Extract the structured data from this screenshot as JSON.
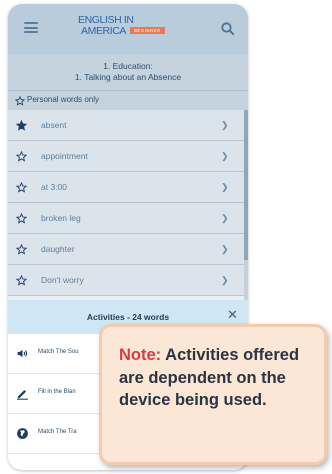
{
  "header": {
    "logo_line1": "ENGLISH IN",
    "logo_line2": "AMERICA",
    "logo_badge": "BEGINNER"
  },
  "lesson": {
    "line1": "1. Education:",
    "line2": "1. Talking about an Absence"
  },
  "filter": {
    "label": "Personal words only"
  },
  "words": [
    {
      "text": "absent",
      "starred": true
    },
    {
      "text": "appointment",
      "starred": false
    },
    {
      "text": "at 3:00",
      "starred": false
    },
    {
      "text": "broken leg",
      "starred": false
    },
    {
      "text": "daughter",
      "starred": false
    },
    {
      "text": "Don't worry",
      "starred": false
    }
  ],
  "activities": {
    "title": "Activities - 24 words",
    "items": [
      {
        "label": "Match The Sou",
        "icon": "speaker-icon"
      },
      {
        "label": "Fill in the Blan",
        "icon": "pencil-icon"
      },
      {
        "label": "Match The Tra",
        "icon": "globe-icon"
      }
    ]
  },
  "note": {
    "prefix": "Note:",
    "text": "Activities offered are dependent on the device being used."
  },
  "colors": {
    "header_bg": "#b8ccdc",
    "star_filled": "#1f3f66",
    "note_highlight": "#d43c42",
    "note_bg": "#fbe7d6"
  }
}
